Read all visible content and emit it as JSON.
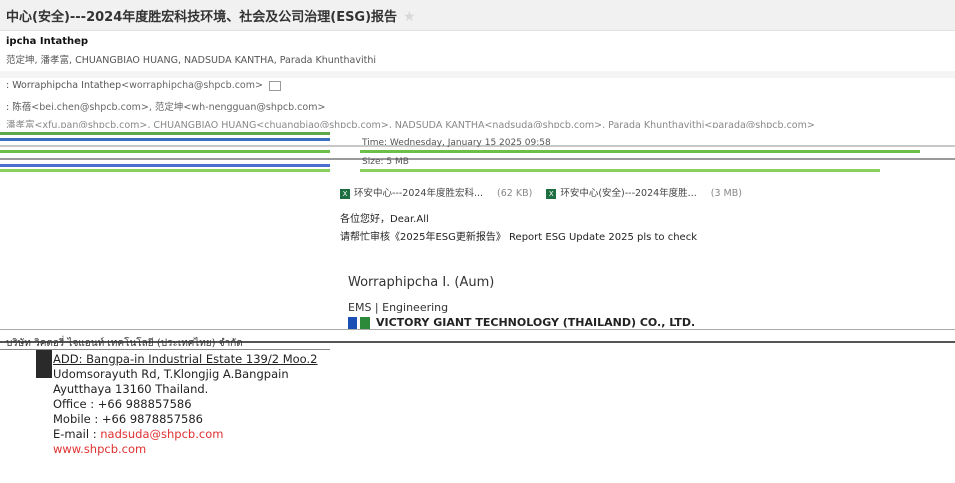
{
  "email": {
    "subject": "中心(安全)---2024年度胜宏科技环境、社会及公司治理(ESG)报告",
    "star": "★",
    "sender_name": "ipcha Intathep",
    "recipients_line": "范定坤, 潘孝富, CHUANGBIAO HUANG, NADSUDA KANTHA, Parada Khunthavithi",
    "from_label": ": Worraphipcha Intathep",
    "from_addr": "<worraphipcha@shpcb.com>",
    "to_label": ": 陈蓓",
    "to_line": "<bei.chen@shpcb.com>, 范定坤<wh-nengguan@shpcb.com>",
    "cc_line": "潘孝富<xfu.pan@shpcb.com>, CHUANGBIAO HUANG<chuangbiao@shpcb.com>, NADSUDA KANTHA<nadsuda@shpcb.com>, Parada Khunthavithi<parada@shpcb.com>",
    "time_line": "Time: Wednesday, January 15 2025 09:58",
    "size_line": "Size: 5 MB"
  },
  "attachments": [
    {
      "name": "环安中心---2024年度胜宏科...",
      "size": "(62 KB)"
    },
    {
      "name": "环安中心(安全)---2024年度胜...",
      "size": "(3 MB)"
    }
  ],
  "body": {
    "greeting": "各位您好，Dear.All",
    "request": "请帮忙审核《2025年ESG更新报告》 Report ESG Update 2025 pls to check"
  },
  "signature": {
    "name": "Worraphipcha I. (Aum)",
    "dept": "EMS | Engineering",
    "company": "VICTORY GIANT TECHNOLOGY (THAILAND) CO., LTD.",
    "thai_line": "บริษัท วิคตอรี่ ไจแอนท์ เทคโนโลยี (ประเทศไทย) จำกัด",
    "address_1": "ADD: Bangpa-in Industrial Estate 139/2 Moo.2",
    "address_2": "Udomsorayuth Rd, T.Klongjig A.Bangpain",
    "address_3": "Ayutthaya 13160 Thailand.",
    "office": "Office : +66 988857586",
    "mobile": "Mobile : +66 9878857586",
    "email_label": "E-mail : ",
    "email": "nadsuda@shpcb.com",
    "website": "www.shpcb.com"
  },
  "colors": {
    "link_red": "#e03131",
    "excel_green": "#1d6f42",
    "glitch_green": "#6cc04a",
    "glitch_blue": "#4a6fd0"
  },
  "icons": [
    "star-icon",
    "excel-file-icon",
    "company-logo-icon",
    "detail-toggle-icon"
  ]
}
